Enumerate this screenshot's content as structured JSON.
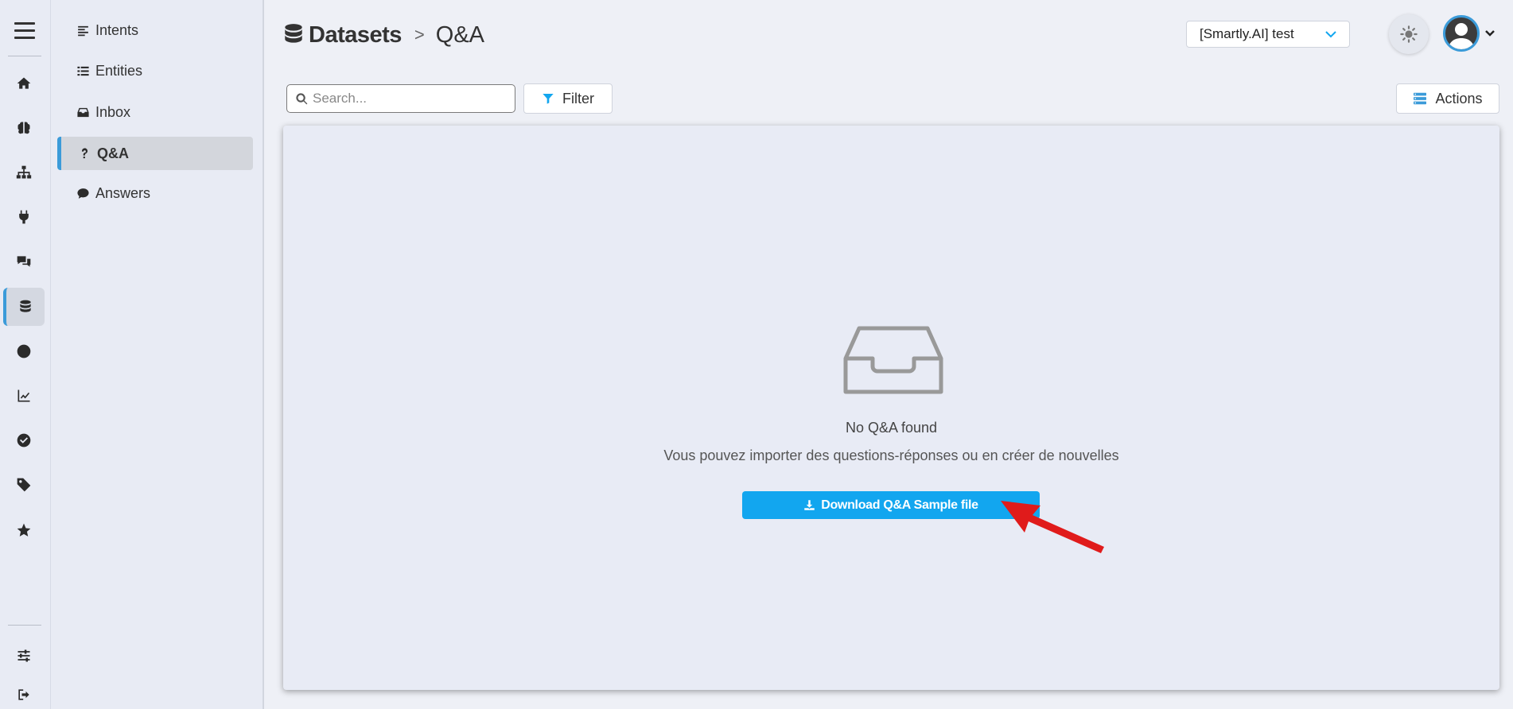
{
  "rail": {
    "items": [
      {
        "icon": "home-icon"
      },
      {
        "icon": "brain-icon"
      },
      {
        "icon": "sitemap-icon"
      },
      {
        "icon": "plug-icon"
      },
      {
        "icon": "comments-icon"
      },
      {
        "icon": "database-icon",
        "active": true
      },
      {
        "icon": "clock-icon"
      },
      {
        "icon": "chart-line-icon"
      },
      {
        "icon": "check-circle-icon"
      },
      {
        "icon": "tag-icon"
      },
      {
        "icon": "star-icon"
      }
    ],
    "bottom": [
      {
        "icon": "sliders-icon"
      },
      {
        "icon": "sign-out-icon"
      }
    ]
  },
  "subnav": {
    "items": [
      {
        "label": "Intents",
        "icon": "align-left-icon"
      },
      {
        "label": "Entities",
        "icon": "list-icon"
      },
      {
        "label": "Inbox",
        "icon": "inbox-icon"
      },
      {
        "label": "Q&A",
        "icon": "question-icon",
        "active": true
      },
      {
        "label": "Answers",
        "icon": "comment-icon"
      }
    ]
  },
  "header": {
    "section": "Datasets",
    "separator": ">",
    "page": "Q&A",
    "project": "[Smartly.AI] test"
  },
  "toolbar": {
    "search_placeholder": "Search...",
    "filter_label": "Filter",
    "actions_label": "Actions"
  },
  "empty_state": {
    "title": "No Q&A found",
    "subtitle": "Vous pouvez importer des questions-réponses ou en créer de nouvelles",
    "download_label": "Download Q&A Sample file"
  },
  "colors": {
    "accent": "#3b9bd9",
    "primary_button": "#12a6ef",
    "annotation_arrow": "#e01b1b"
  }
}
